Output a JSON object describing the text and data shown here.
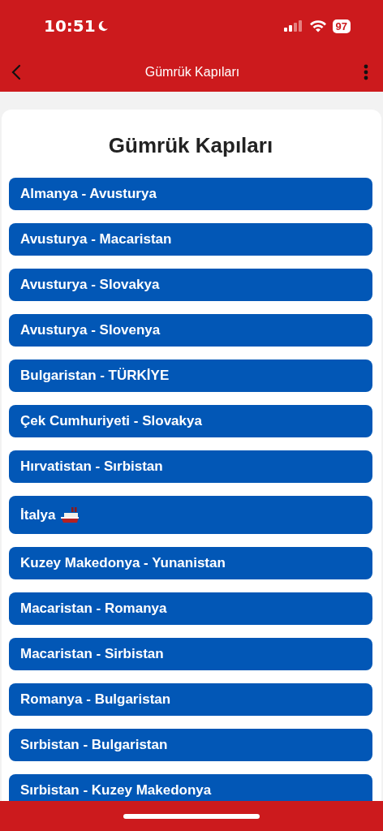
{
  "status_bar": {
    "time": "10:51",
    "battery": "97"
  },
  "nav_bar": {
    "title": "Gümrük Kapıları"
  },
  "page": {
    "heading": "Gümrük Kapıları",
    "items": [
      {
        "label": "Almanya - Avusturya",
        "kind": "border"
      },
      {
        "label": "Avusturya - Macaristan",
        "kind": "border"
      },
      {
        "label": "Avusturya - Slovakya",
        "kind": "border"
      },
      {
        "label": "Avusturya - Slovenya",
        "kind": "border"
      },
      {
        "label": "Bulgaristan - TÜRKİYE",
        "kind": "border"
      },
      {
        "label": "Çek Cumhuriyeti - Slovakya",
        "kind": "border"
      },
      {
        "label": "Hırvatistan - Sırbistan",
        "kind": "border"
      },
      {
        "label": "İtalya",
        "kind": "ferry"
      },
      {
        "label": "Kuzey Makedonya - Yunanistan",
        "kind": "border"
      },
      {
        "label": "Macaristan - Romanya",
        "kind": "border"
      },
      {
        "label": "Macaristan - Sirbistan",
        "kind": "border"
      },
      {
        "label": "Romanya - Bulgaristan",
        "kind": "border"
      },
      {
        "label": "Sırbistan - Bulgaristan",
        "kind": "border"
      },
      {
        "label": "Sırbistan - Kuzey Makedonya",
        "kind": "border"
      }
    ]
  }
}
